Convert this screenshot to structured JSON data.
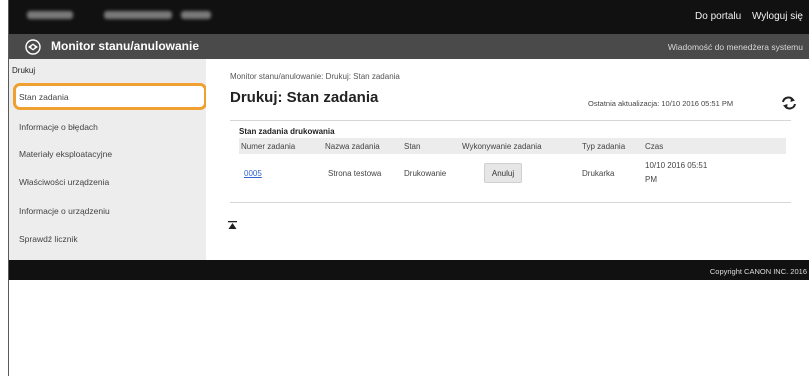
{
  "topbar": {
    "portal_link": "Do portalu",
    "logout_link": "Wyloguj się"
  },
  "header": {
    "app_title": "Monitor stanu/anulowanie",
    "message_link": "Wiadomość do menedżera systemu"
  },
  "sidebar": {
    "section": "Drukuj",
    "items": [
      {
        "label": "Stan zadania",
        "selected": true
      },
      {
        "label": "Informacje o błędach"
      },
      {
        "label": "Materiały eksploatacyjne"
      },
      {
        "label": "Właściwości urządzenia"
      },
      {
        "label": "Informacje o urządzeniu"
      },
      {
        "label": "Sprawdź licznik"
      }
    ]
  },
  "main": {
    "breadcrumb": "Monitor stanu/anulowanie: Drukuj: Stan zadania",
    "title": "Drukuj: Stan zadania",
    "last_update": "Ostatnia aktualizacja: 10/10 2016 05:51 PM",
    "table_title": "Stan zadania drukowania",
    "columns": [
      "Numer zadania",
      "Nazwa zadania",
      "Stan",
      "Wykonywanie zadania",
      "Typ zadania",
      "Czas"
    ],
    "rows": [
      {
        "job_number": "0005",
        "job_name": "Strona testowa",
        "status": "Drukowanie",
        "action": "Anuluj",
        "job_type": "Drukarka",
        "time_line1": "10/10 2016 05:51",
        "time_line2": "PM"
      }
    ]
  },
  "footer": {
    "copyright": "Copyright CANON INC. 2016"
  },
  "icons": {
    "logo": "canon-logo-icon",
    "refresh": "refresh-icon",
    "scroll_top": "scroll-to-top-icon"
  },
  "colors": {
    "highlight": "#f0a030",
    "link": "#3366cc",
    "topbar": "#111111",
    "header": "#4a4a4a"
  }
}
